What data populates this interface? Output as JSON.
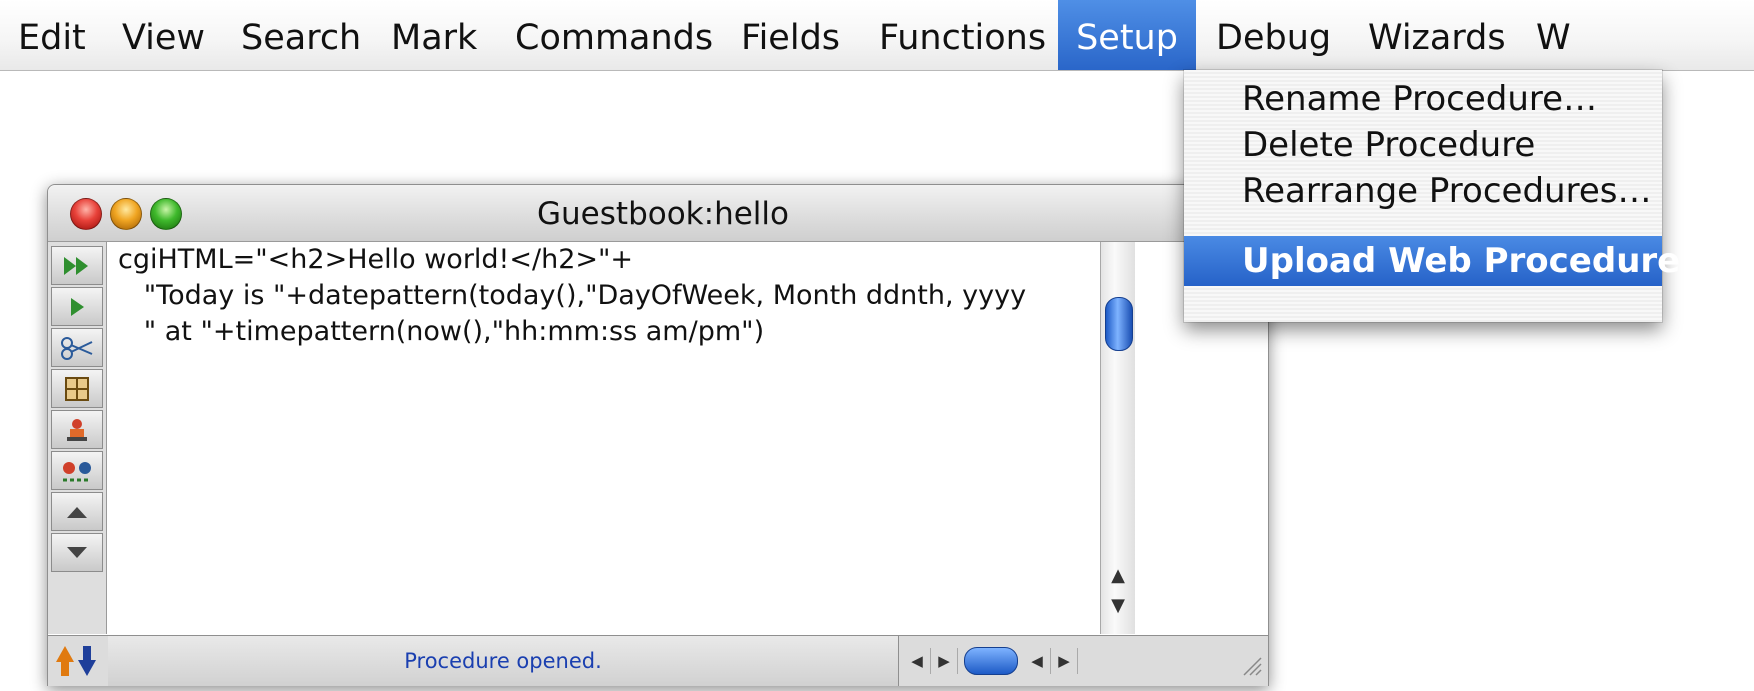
{
  "menubar": {
    "items": [
      "Edit",
      "View",
      "Search",
      "Mark",
      "Commands",
      "Fields",
      "Functions",
      "Setup",
      "Debug",
      "Wizards",
      "W"
    ],
    "active": "Setup"
  },
  "dropdown": {
    "items": [
      "Rename Procedure…",
      "Delete Procedure",
      "Rearrange Procedures…",
      "Upload Web Procedure"
    ],
    "highlighted": "Upload Web Procedure"
  },
  "window": {
    "title": "Guestbook:hello",
    "code": [
      "cgiHTML=\"<h2>Hello world!</h2>\"+",
      "   \"Today is \"+datepattern(today(),\"DayOfWeek, Month ddnth, yyyy",
      "   \" at \"+timepattern(now(),\"hh:mm:ss am/pm\")"
    ],
    "status": "Procedure opened."
  },
  "colors": {
    "menu_highlight": "#2a66c9",
    "status_text": "#1a3fb0"
  },
  "icons": [
    "fast-forward-icon",
    "play-icon",
    "scissors-icon",
    "grid-icon",
    "stamp-icon",
    "debug-icon",
    "scroll-up-icon",
    "scroll-down-icon",
    "up-down-arrows-icon"
  ]
}
